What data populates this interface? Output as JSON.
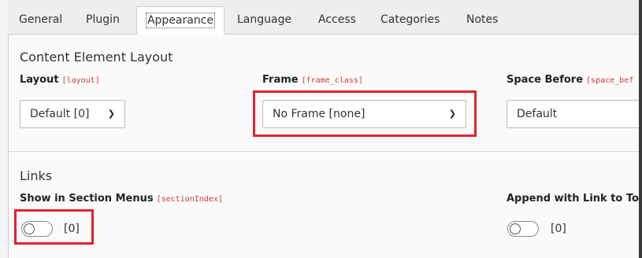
{
  "tabs": [
    {
      "label": "General"
    },
    {
      "label": "Plugin"
    },
    {
      "label": "Appearance",
      "active": true
    },
    {
      "label": "Language"
    },
    {
      "label": "Access"
    },
    {
      "label": "Categories"
    },
    {
      "label": "Notes"
    }
  ],
  "layout_section": {
    "title": "Content Element Layout",
    "layout": {
      "label": "Layout",
      "key": "[layout]",
      "value": "Default [0]"
    },
    "frame": {
      "label": "Frame",
      "key": "[frame_class]",
      "value": "No Frame [none]"
    },
    "space_before": {
      "label": "Space Before",
      "key": "[space_bef",
      "value": "Default"
    }
  },
  "links_section": {
    "title": "Links",
    "section_menus": {
      "label": "Show in Section Menus",
      "key": "[sectionIndex]",
      "value": "[0]"
    },
    "append_link": {
      "label": "Append with Link to To",
      "value": "[0]"
    }
  },
  "colors": {
    "highlight": "#e0242f",
    "field_key": "#c83c3c"
  },
  "icons": {
    "select_chevron": "chevron-down-icon",
    "toggle": "toggle-switch-icon"
  }
}
